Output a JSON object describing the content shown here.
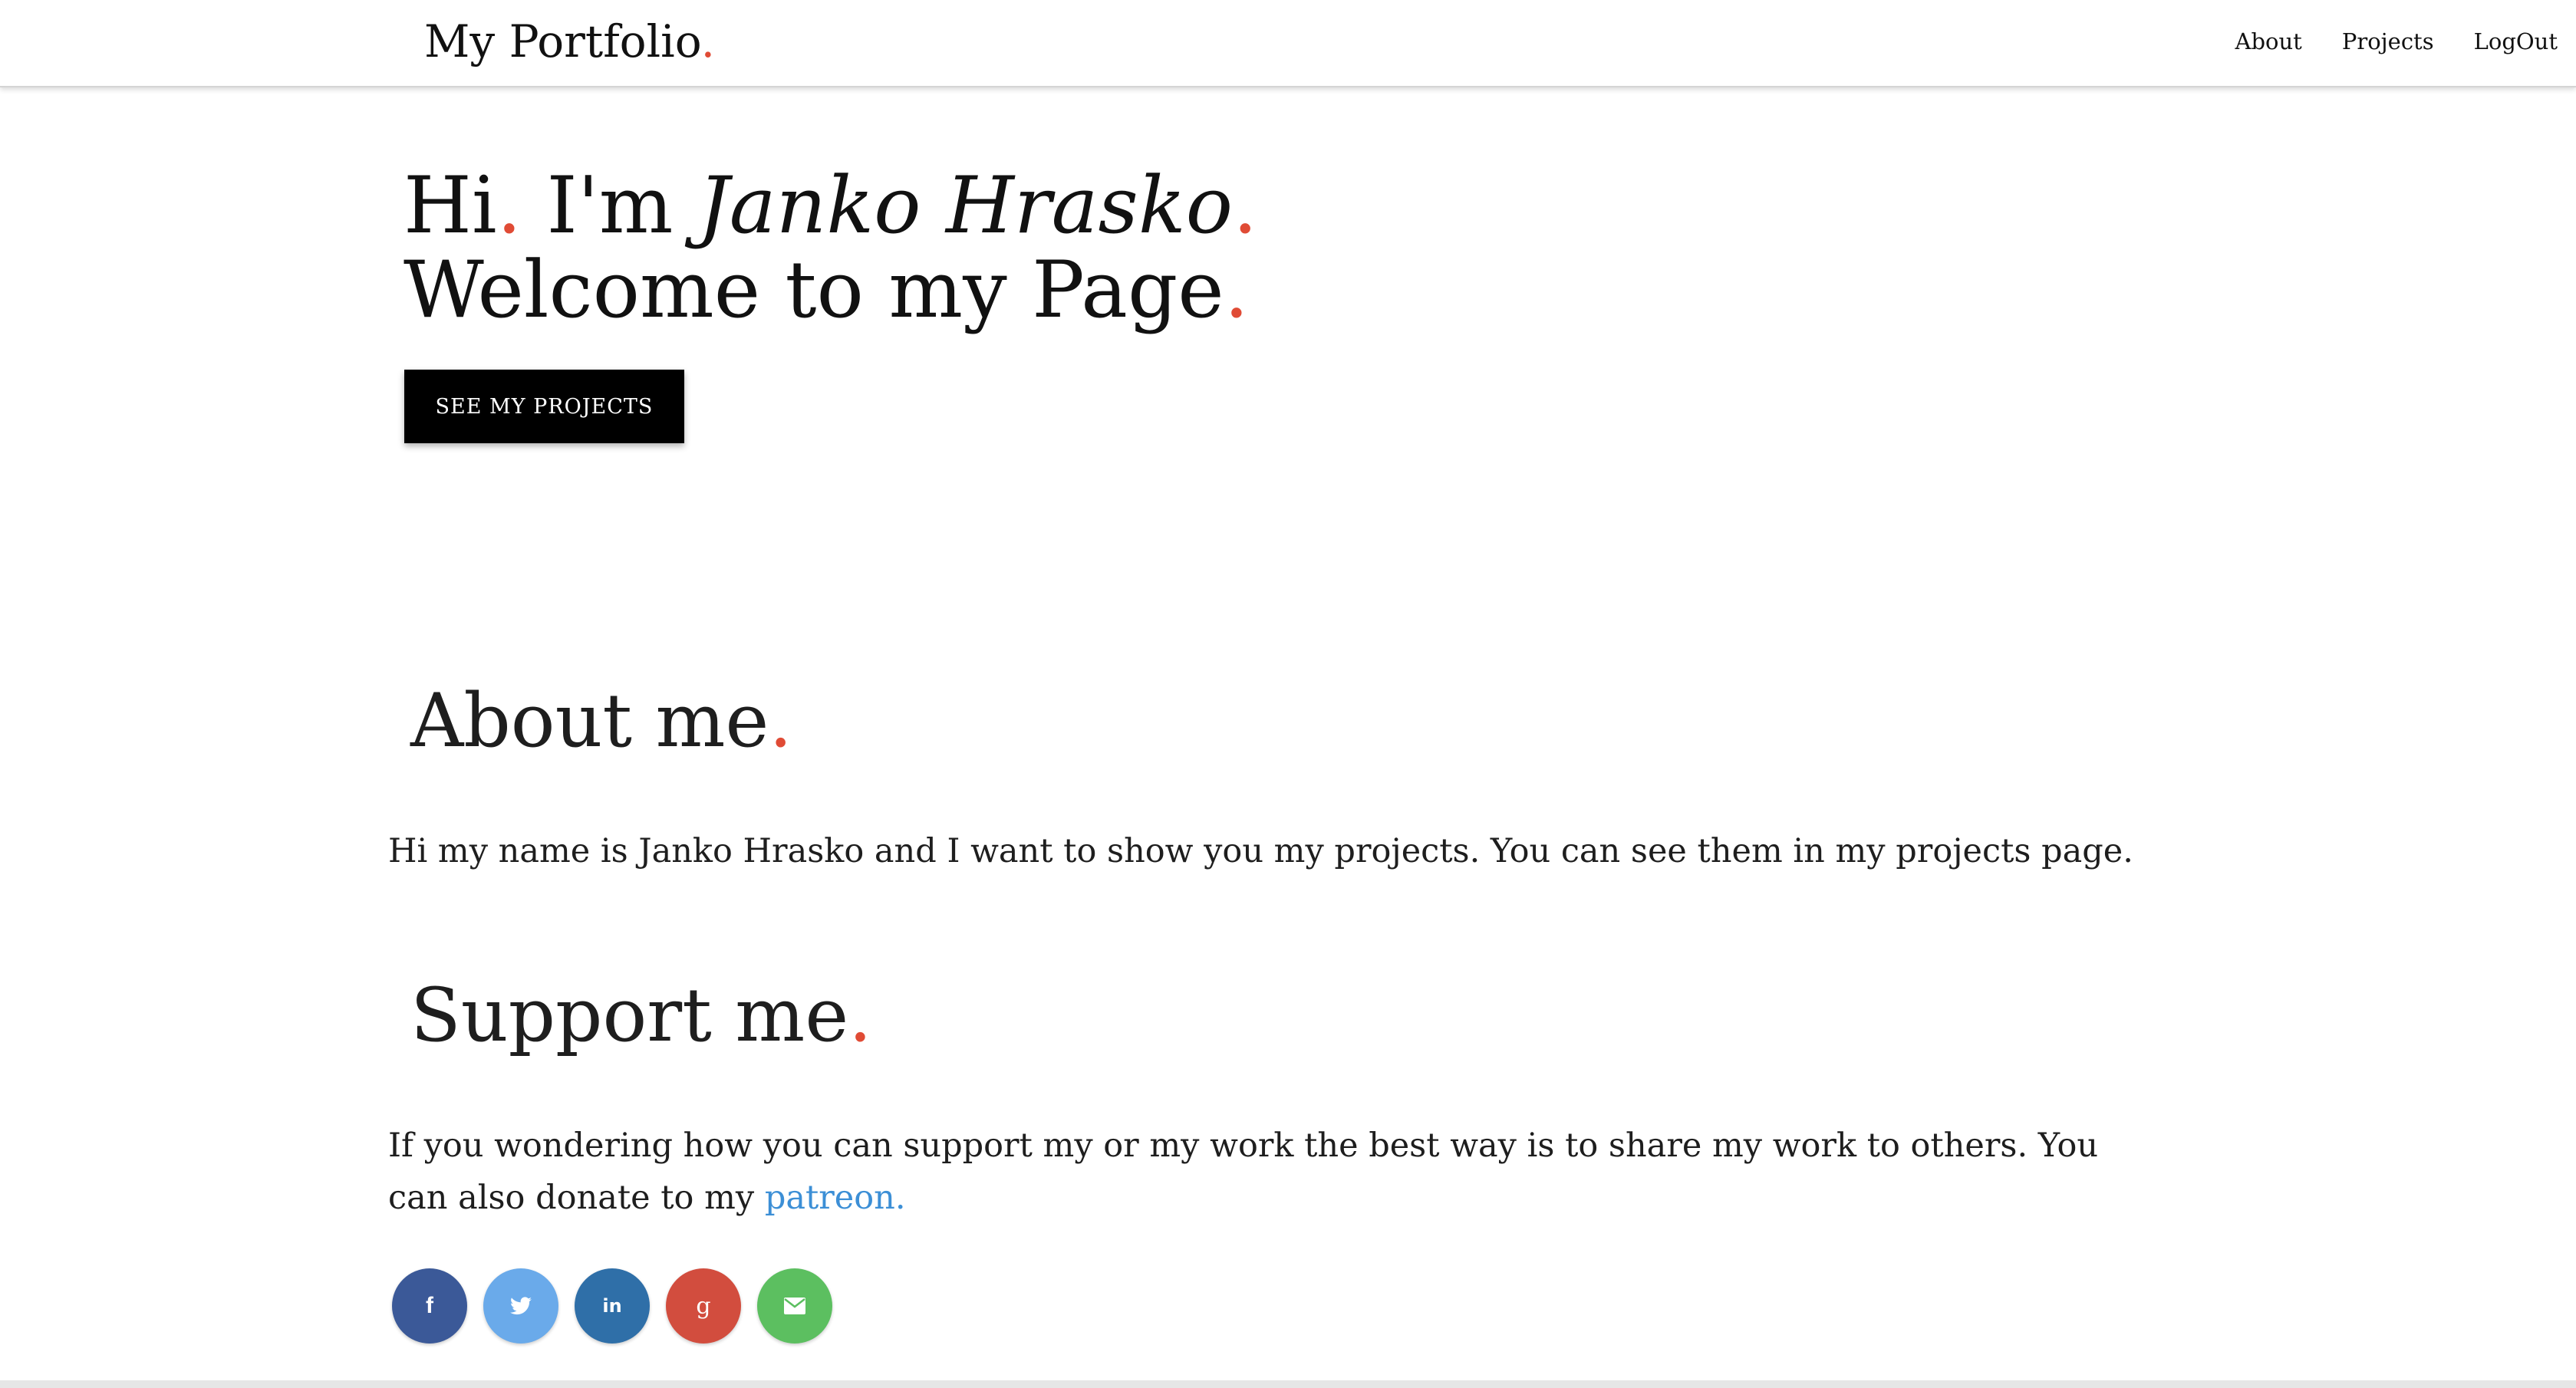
{
  "navbar": {
    "brand": "My Portfolio",
    "brand_dot": ".",
    "links": [
      {
        "label": "About"
      },
      {
        "label": "Projects"
      },
      {
        "label": "LogOut"
      }
    ]
  },
  "hero": {
    "line1_hi": "Hi",
    "line1_im": " I'm ",
    "line1_name": "Janko Hrasko",
    "line2": "Welcome to my Page",
    "dot": ".",
    "button_label": "SEE MY PROJECTS"
  },
  "about": {
    "title": "About me",
    "text": "Hi my name is Janko Hrasko and I want to show you my projects. You can see them in my projects page."
  },
  "support": {
    "title": "Support me",
    "text_before": "If you wondering how you can support my or my work the best way is to share my work to others. You can also donate to my ",
    "link_label": "patreon."
  },
  "social": [
    {
      "name": "facebook-icon",
      "glyph": "f",
      "color": "#3b5998"
    },
    {
      "name": "twitter-icon",
      "glyph": "",
      "color": "#6aaaea"
    },
    {
      "name": "linkedin-icon",
      "glyph": "in",
      "color": "#2f6fa8"
    },
    {
      "name": "google-plus-icon",
      "glyph": "g",
      "color": "#d24d3e"
    },
    {
      "name": "email-icon",
      "glyph": "",
      "color": "#5cbf60"
    }
  ],
  "colors": {
    "accent_dot": "#e04b35",
    "link": "#3c8fd6",
    "button_bg": "#000000"
  }
}
